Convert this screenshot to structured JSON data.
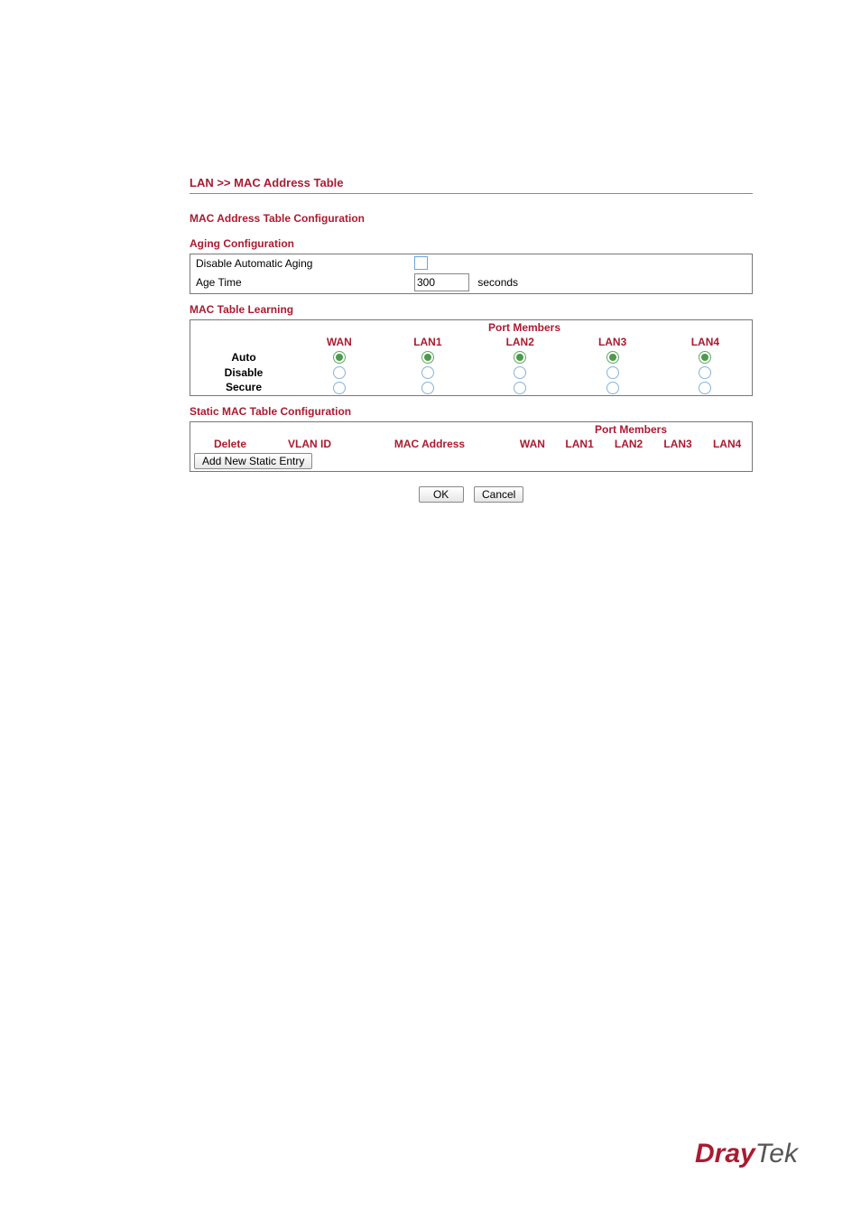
{
  "breadcrumb": "LAN >> MAC Address Table",
  "titles": {
    "main": "MAC Address Table Configuration",
    "aging": "Aging Configuration",
    "learning": "MAC Table Learning",
    "static": "Static MAC Table Configuration"
  },
  "aging": {
    "disable_label": "Disable Automatic Aging",
    "age_time_label": "Age Time",
    "age_time_value": "300",
    "age_unit": "seconds"
  },
  "learning": {
    "pm_header": "Port Members",
    "cols": [
      "WAN",
      "LAN1",
      "LAN2",
      "LAN3",
      "LAN4"
    ],
    "rows": [
      "Auto",
      "Disable",
      "Secure"
    ]
  },
  "static": {
    "pm_header": "Port Members",
    "headers": {
      "delete": "Delete",
      "vlan": "VLAN ID",
      "mac": "MAC Address",
      "wan": "WAN",
      "lan1": "LAN1",
      "lan2": "LAN2",
      "lan3": "LAN3",
      "lan4": "LAN4"
    },
    "add_btn": "Add New Static Entry"
  },
  "buttons": {
    "ok": "OK",
    "cancel": "Cancel"
  },
  "logo": {
    "part1": "Dray",
    "part2": "Tek"
  }
}
